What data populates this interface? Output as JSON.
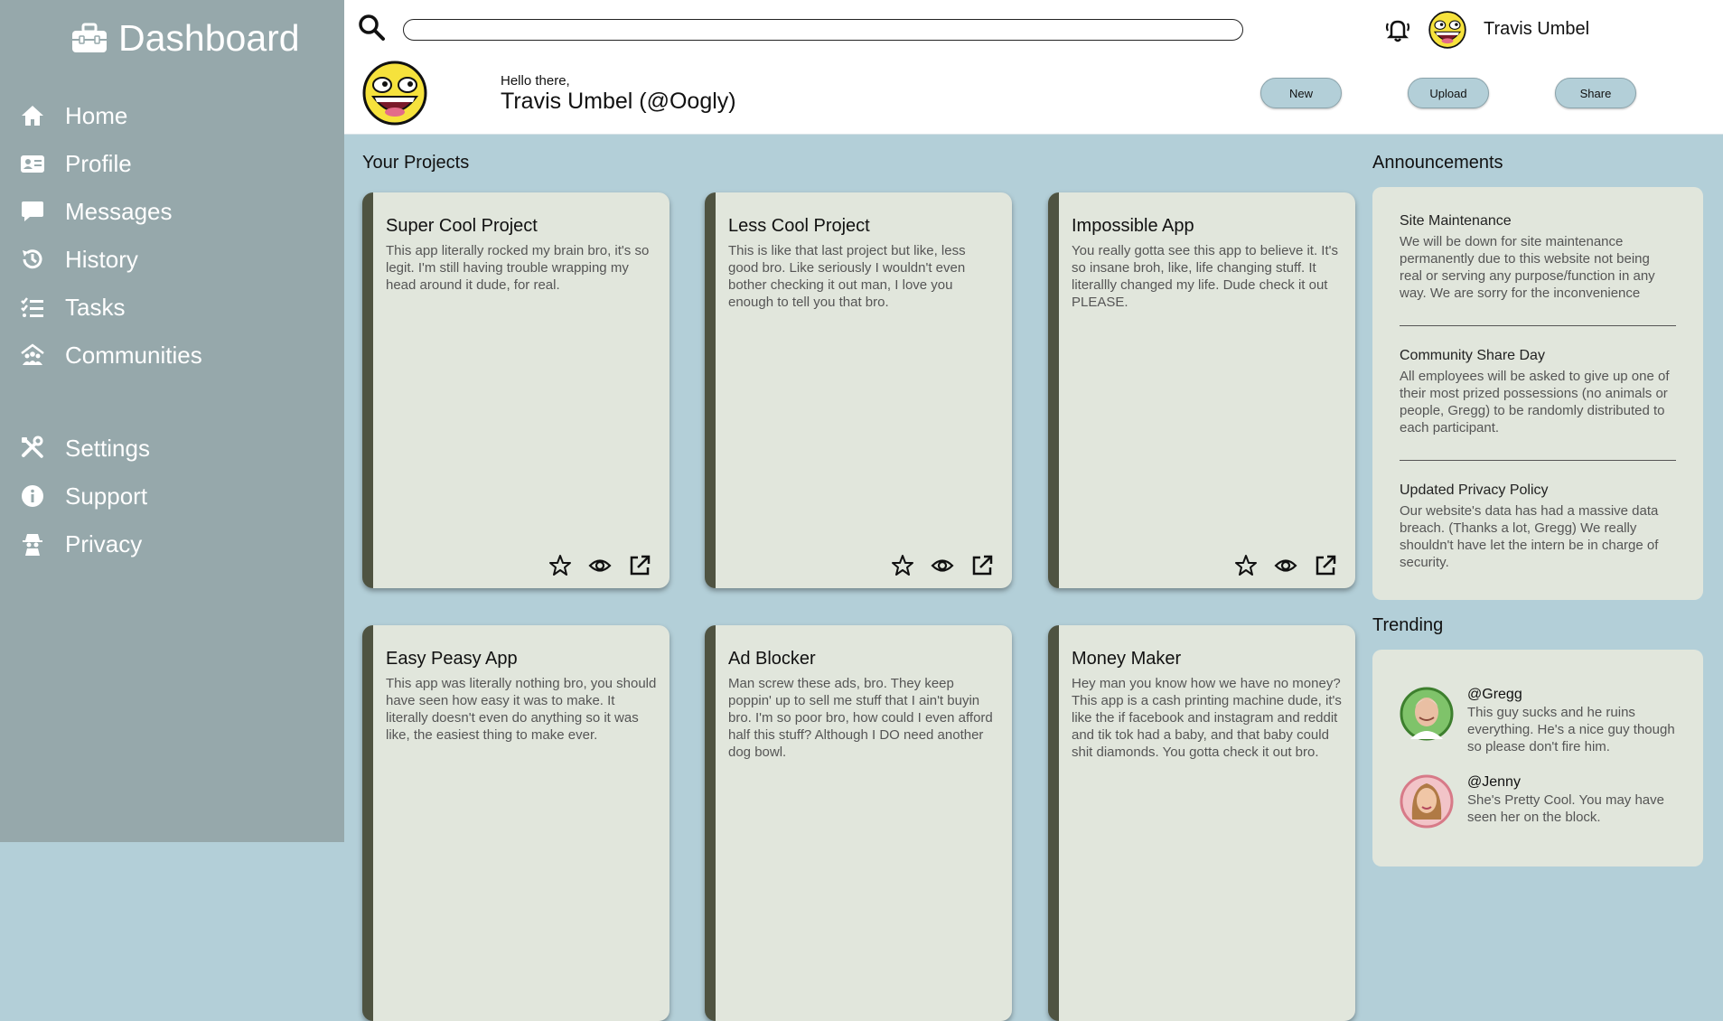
{
  "sidebar": {
    "brand": "Dashboard",
    "items": [
      {
        "label": "Home",
        "icon": "home-icon"
      },
      {
        "label": "Profile",
        "icon": "id-card-icon"
      },
      {
        "label": "Messages",
        "icon": "chat-bubble-icon"
      },
      {
        "label": "History",
        "icon": "history-icon"
      },
      {
        "label": "Tasks",
        "icon": "task-list-icon"
      },
      {
        "label": "Communities",
        "icon": "community-icon"
      },
      {
        "label": "Settings",
        "icon": "tools-icon"
      },
      {
        "label": "Support",
        "icon": "info-icon"
      },
      {
        "label": "Privacy",
        "icon": "spy-icon"
      }
    ]
  },
  "header": {
    "search": {
      "placeholder": "",
      "value": ""
    },
    "username": "Travis Umbel",
    "greeting": "Hello there,",
    "handle": "Travis Umbel (@Oogly)",
    "buttons": {
      "new": "New",
      "upload": "Upload",
      "share": "Share"
    }
  },
  "projects": {
    "heading": "Your Projects",
    "cards": [
      {
        "title": "Super Cool Project",
        "description": "This app literally rocked my brain bro, it's so legit. I'm still having trouble wrapping my head around it dude, for real."
      },
      {
        "title": "Less Cool Project",
        "description": "This is like that last project but like, less good bro. Like seriously I wouldn't even bother checking it out man, I love you enough to tell you that bro."
      },
      {
        "title": "Impossible App",
        "description": "You really gotta see this app to believe it. It's so insane broh, like, life changing stuff. It literallly changed my life. Dude check it out PLEASE."
      },
      {
        "title": "Easy Peasy App",
        "description": "This app was literally nothing bro, you should have seen how easy it was to make. It literally doesn't even do anything so it was like, the easiest thing to make ever."
      },
      {
        "title": "Ad Blocker",
        "description": "Man screw these ads, bro. They keep poppin' up to sell me stuff that I ain't buyin bro. I'm so poor bro, how could I even afford half this stuff? Although I DO need another dog bowl."
      },
      {
        "title": "Money Maker",
        "description": "Hey man you know how we have no money? This app is a cash printing machine dude, it's like the if facebook and instagram and reddit and tik tok had a baby, and that baby could shit diamonds. You gotta check it out bro."
      }
    ]
  },
  "announcements": {
    "heading": "Announcements",
    "items": [
      {
        "title": "Site Maintenance",
        "body": "We will be down for site maintenance permanently due to this website not being real or serving any purpose/function in any way. We are sorry for the inconvenience"
      },
      {
        "title": "Community Share Day",
        "body": "All employees will be asked to give up one of their most prized possessions (no animals or people, Gregg) to be randomly distributed to each participant."
      },
      {
        "title": "Updated Privacy Policy",
        "body": "Our website's data has had a massive data breach. (Thanks a lot, Gregg) We really shouldn't have let the intern be in charge of security."
      }
    ]
  },
  "trending": {
    "heading": "Trending",
    "items": [
      {
        "handle": "@Gregg",
        "body": "This guy sucks and he ruins everything. He's a nice guy though so please don't fire him."
      },
      {
        "handle": "@Jenny",
        "body": "She's Pretty Cool. You may have seen her on the block."
      }
    ]
  },
  "colors": {
    "sidebar": "#96a8ab",
    "background": "#b3cfd8",
    "card": "#e1e6dc",
    "card_accent": "#4f5341"
  }
}
